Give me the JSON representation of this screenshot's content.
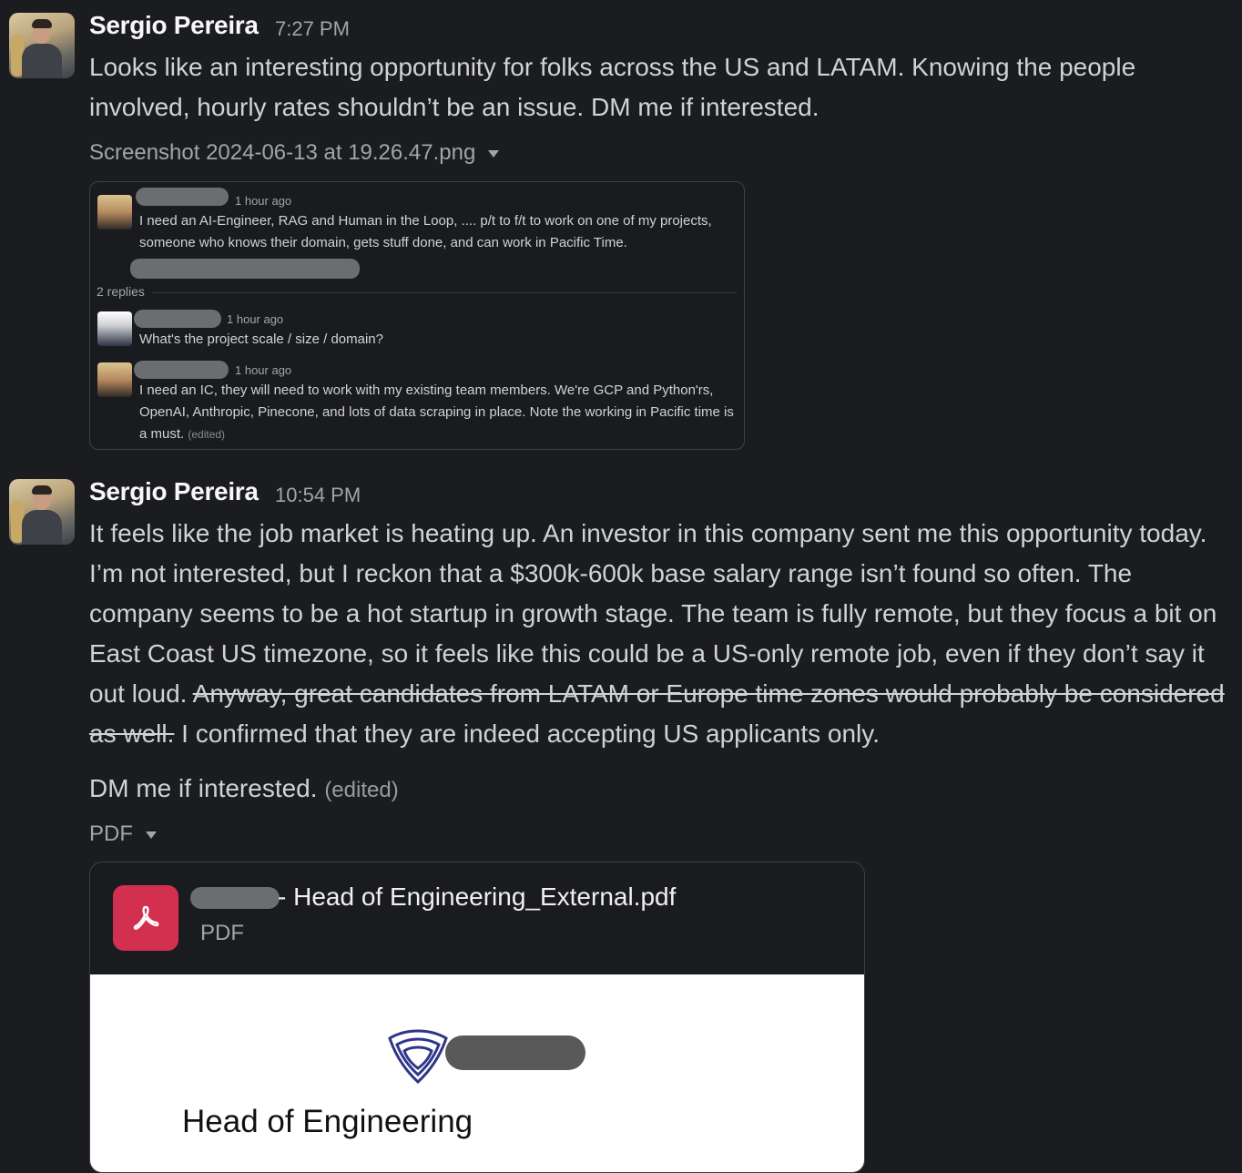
{
  "messages": [
    {
      "author": "Sergio Pereira",
      "time": "7:27 PM",
      "text": "Looks like an interesting opportunity for folks across the US and LATAM. Knowing the people involved, hourly rates shouldn’t be an issue. DM me if interested.",
      "attachment": {
        "label": "Screenshot 2024-06-13 at 19.26.47.png",
        "thread": {
          "post": {
            "time": "1 hour ago",
            "text": "I need an AI-Engineer, RAG and Human in the Loop, .... p/t to f/t  to work on one of my projects, someone who knows their domain, gets stuff done, and can work in Pacific Time."
          },
          "replies_count": "2 replies",
          "replies": [
            {
              "time": "1 hour ago",
              "text": "What's the project scale / size / domain?"
            },
            {
              "time": "1 hour ago",
              "text": "I need an IC, they will  need to work  with my existing team members. We're GCP and Python'rs, OpenAI, Anthropic, Pinecone,  and lots of data scraping in place. Note the working in Pacific time is a must.",
              "edited": "(edited)"
            }
          ]
        }
      }
    },
    {
      "author": "Sergio Pereira",
      "time": "10:54 PM",
      "text_main": "It feels like the job market is heating up. An investor in this company sent me this opportunity today. I’m not interested, but I reckon that a $300k-600k base salary range isn’t found so often. The company seems to be a hot startup in growth stage. The team is fully remote, but they focus a bit on East Coast US timezone, so it feels like this could be a US-only remote job, even if they don’t say it out loud. ",
      "text_struck": "Anyway, great candidates from LATAM or Europe time zones would probably be considered as well.",
      "text_after": " I confirmed that they are indeed accepting US applicants only.",
      "text_second": "DM me if interested.",
      "edited": "(edited)",
      "attachment": {
        "label": "PDF",
        "file_name": "- Head of Engineering_External.pdf",
        "file_type": "PDF",
        "preview_title": "Head of Engineering"
      }
    }
  ],
  "colors": {
    "background": "#1b1c1f",
    "pdf_icon": "#d3304f"
  }
}
